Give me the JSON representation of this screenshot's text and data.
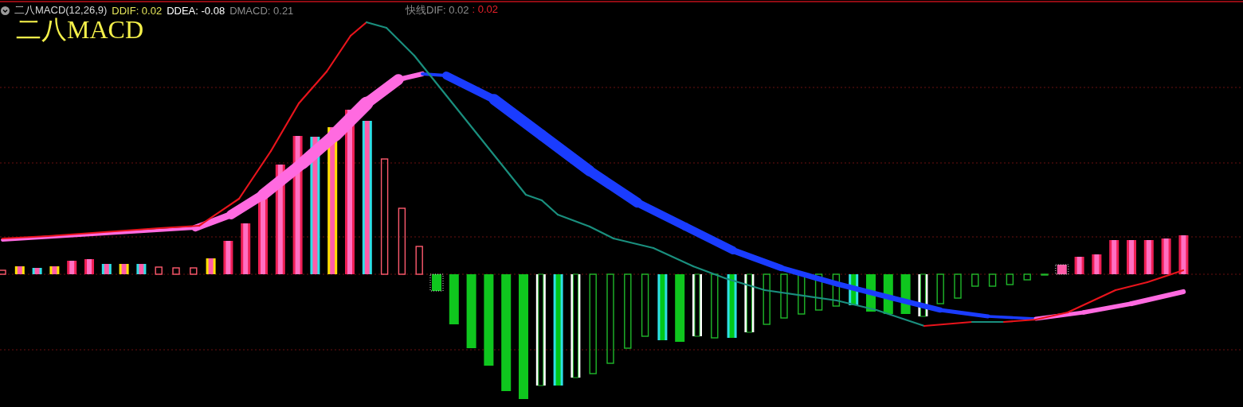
{
  "indicator": {
    "name": "二八MACD(12,26,9)",
    "title": "二八MACD",
    "collapsed": false
  },
  "legend": [
    {
      "text": "DDIF: 0.02",
      "color": "#e6e65a"
    },
    {
      "text": "DDEA: -0.08",
      "color": "#ffffff"
    },
    {
      "text": "DMACD: 0.21",
      "color": "#8c8c8c"
    }
  ],
  "fast_line": [
    {
      "text": "快线DIF: 0.02",
      "color": "#8c8c8c"
    },
    {
      "text": ": 0.02",
      "color": "#e8202a"
    }
  ]
}
